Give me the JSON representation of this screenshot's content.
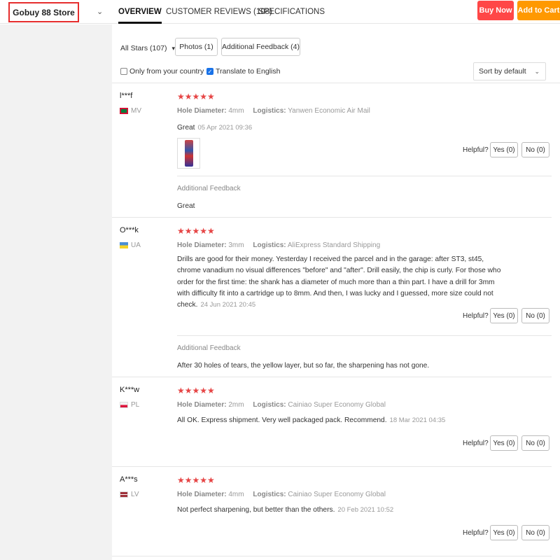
{
  "header": {
    "store_name": "Gobuy 88 Store",
    "tabs": [
      {
        "label": "OVERVIEW"
      },
      {
        "label": "CUSTOMER REVIEWS (108)"
      },
      {
        "label": "SPECIFICATIONS"
      }
    ],
    "buy_now": "Buy Now",
    "add_to_cart": "Add to Cart",
    "colors": {
      "buy": "#ff4747",
      "cart": "#ff9900",
      "store_box_border": "#e62e2e"
    }
  },
  "filters": {
    "stars": "All Stars (107)",
    "photos": "Photos (1)",
    "additional_feedback": "Additional Feedback (4)",
    "only_country": "Only from your country",
    "only_country_checked": false,
    "translate": "Translate to English",
    "translate_checked": true,
    "sort": "Sort by default"
  },
  "labels": {
    "hole_diameter": "Hole Diameter:",
    "logistics": "Logistics:",
    "helpful": "Helpful?",
    "additional_feedback": "Additional Feedback",
    "stars": "★★★★★"
  },
  "reviews": [
    {
      "user": "l***f",
      "country": "MV",
      "rating": 5,
      "hole": "4mm",
      "logistics": "Yanwen Economic Air Mail",
      "text": "Great",
      "date": "05 Apr 2021 09:36",
      "yes": "Yes (0)",
      "no": "No (0)",
      "additional": "Great"
    },
    {
      "user": "O***k",
      "country": "UA",
      "rating": 5,
      "hole": "3mm",
      "logistics": "AliExpress Standard Shipping",
      "text": "Drills are good for their money. Yesterday I received the parcel and in the garage: after ST3, st45, chrome vanadium no visual differences \"before\" and \"after\". Drill easily, the chip is curly. For those who order for the first time: the shank has a diameter of much more than a thin part. I have a drill for 3mm with difficulty fit into a cartridge up to 8mm. And then, I was lucky and I guessed, more size could not check.",
      "date": "24 Jun 2021 20:45",
      "yes": "Yes (0)",
      "no": "No (0)",
      "additional": "After 30 holes of tears, the yellow layer, but so far, the sharpening has not gone."
    },
    {
      "user": "K***w",
      "country": "PL",
      "rating": 5,
      "hole": "2mm",
      "logistics": "Cainiao Super Economy Global",
      "text": "All OK. Express shipment. Very well packaged pack. Recommend.",
      "date": "18 Mar 2021 04:35",
      "yes": "Yes (0)",
      "no": "No (0)"
    },
    {
      "user": "A***s",
      "country": "LV",
      "rating": 5,
      "hole": "4mm",
      "logistics": "Cainiao Super Economy Global",
      "text": "Not perfect sharpening, but better than the others.",
      "date": "20 Feb 2021 10:52",
      "yes": "Yes (0)",
      "no": "No (0)"
    }
  ]
}
